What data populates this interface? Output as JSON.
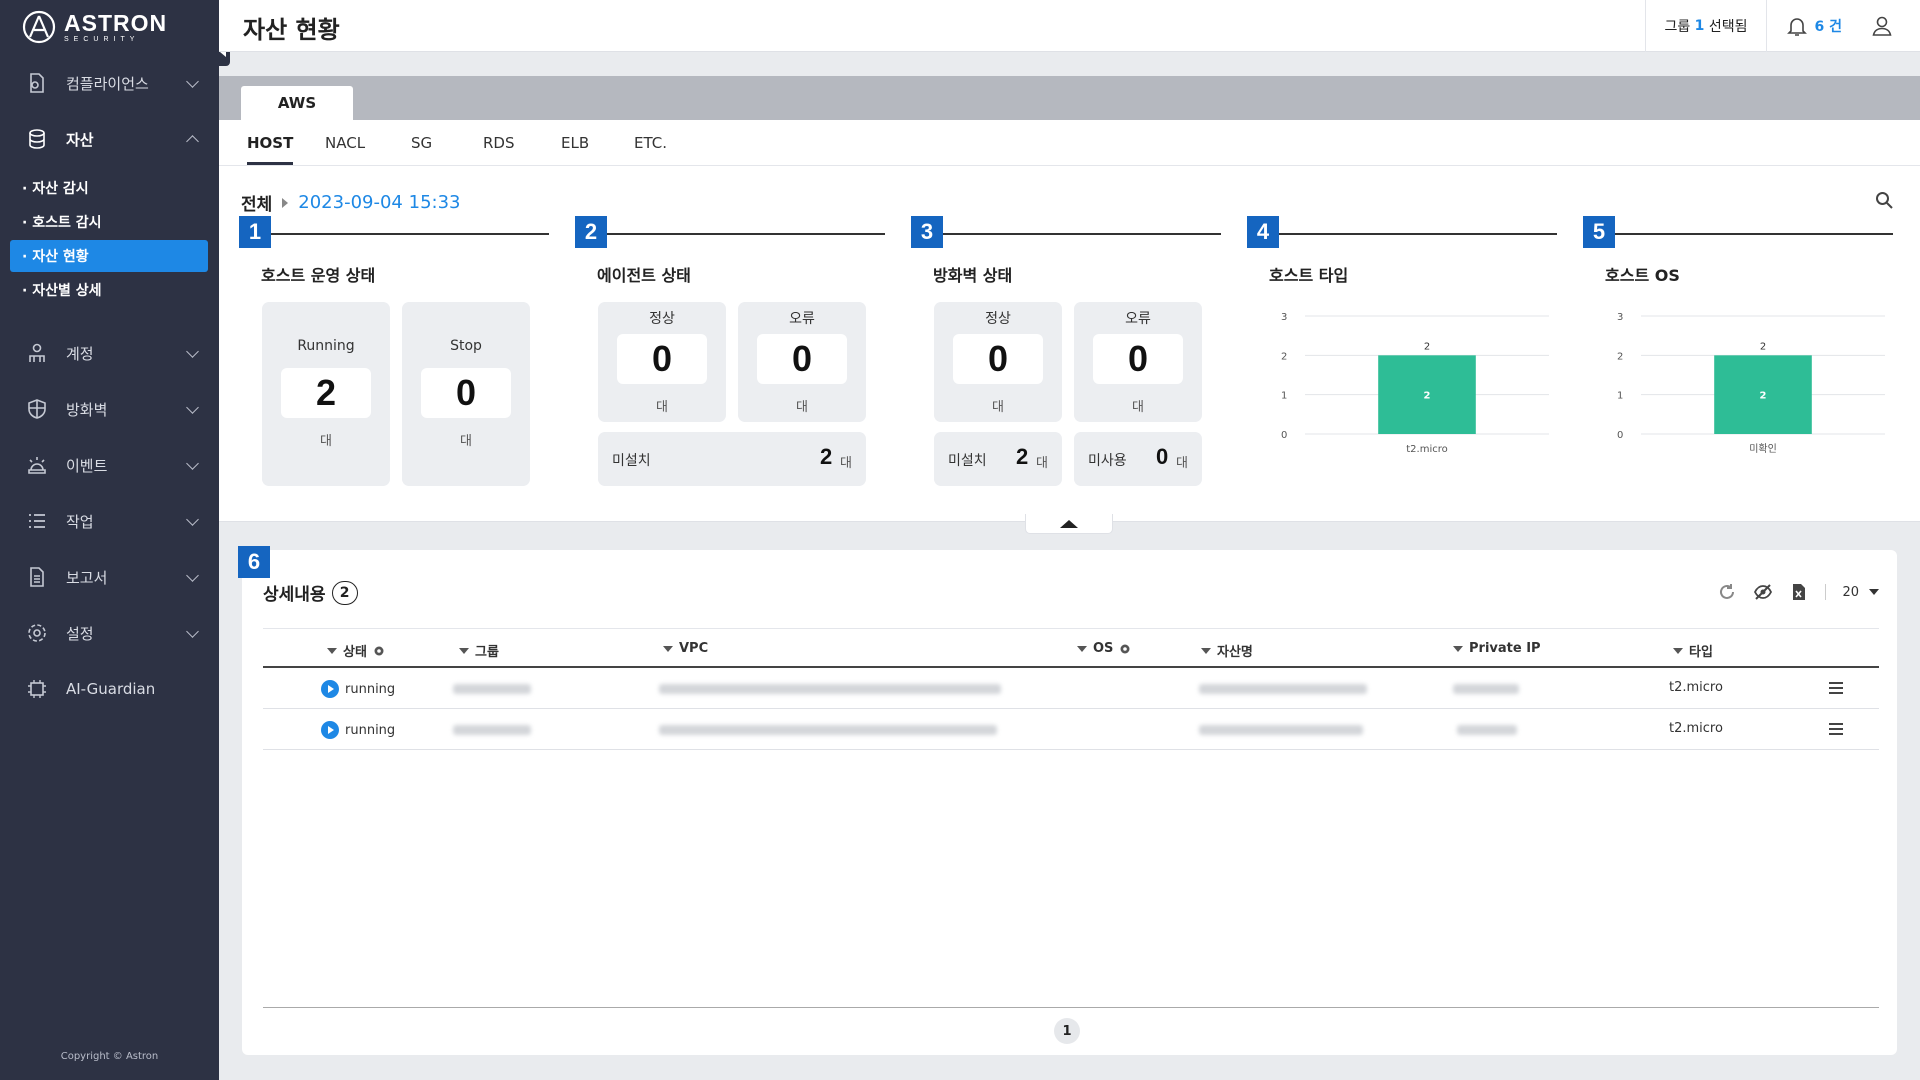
{
  "brand": {
    "name": "ASTRON",
    "tagline": "SECURITY"
  },
  "header": {
    "title": "자산 현황",
    "group_prefix": "그룹",
    "group_count": "1",
    "group_suffix": "선택됨",
    "notif_count": "6 건"
  },
  "sidebar": {
    "items": [
      {
        "label": "컴플라이언스",
        "icon": "compliance-icon"
      },
      {
        "label": "자산",
        "icon": "database-icon"
      },
      {
        "label": "계정",
        "icon": "account-icon"
      },
      {
        "label": "방화벽",
        "icon": "shield-icon"
      },
      {
        "label": "이벤트",
        "icon": "alarm-icon"
      },
      {
        "label": "작업",
        "icon": "list-icon"
      },
      {
        "label": "보고서",
        "icon": "report-icon"
      },
      {
        "label": "설정",
        "icon": "gear-icon"
      },
      {
        "label": "AI-Guardian",
        "icon": "ai-chip-icon"
      }
    ],
    "subitems": [
      "· 자산 감시",
      "· 호스트 감시",
      "· 자산 현황",
      "· 자산별 상세"
    ],
    "copyright": "Copyright © Astron"
  },
  "tabs": {
    "cloud": "AWS",
    "sub": [
      "HOST",
      "NACL",
      "SG",
      "RDS",
      "ELB",
      "ETC."
    ]
  },
  "summary": {
    "crumb_all": "전체",
    "datetime": "2023-09-04 15:33",
    "host_status": {
      "badge": "1",
      "title": "호스트 운영 상태",
      "running_label": "Running",
      "running_value": "2",
      "stop_label": "Stop",
      "stop_value": "0",
      "unit": "대"
    },
    "agent_status": {
      "badge": "2",
      "title": "에이전트 상태",
      "normal_label": "정상",
      "normal_value": "0",
      "error_label": "오류",
      "error_value": "0",
      "unit": "대",
      "uninstalled_label": "미설치",
      "uninstalled_value": "2"
    },
    "firewall_status": {
      "badge": "3",
      "title": "방화벽 상태",
      "normal_label": "정상",
      "normal_value": "0",
      "error_label": "오류",
      "error_value": "0",
      "unit": "대",
      "uninstalled_label": "미설치",
      "uninstalled_value": "2",
      "unused_label": "미사용",
      "unused_value": "0"
    },
    "host_type": {
      "badge": "4",
      "title": "호스트 타입"
    },
    "host_os": {
      "badge": "5",
      "title": "호스트 OS"
    }
  },
  "chart_data": [
    {
      "type": "bar",
      "title": "호스트 타입",
      "categories": [
        "t2.micro"
      ],
      "values": [
        2
      ],
      "ylim": [
        0,
        3
      ],
      "yticks": [
        "0",
        "1",
        "2",
        "3"
      ],
      "color": "#2ebd96"
    },
    {
      "type": "bar",
      "title": "호스트 OS",
      "categories": [
        "미확인"
      ],
      "values": [
        2
      ],
      "ylim": [
        0,
        3
      ],
      "yticks": [
        "0",
        "1",
        "2",
        "3"
      ],
      "color": "#2ebd96"
    }
  ],
  "detail": {
    "badge": "6",
    "title": "상세내용",
    "count": "2",
    "page_size": "20",
    "columns": [
      "상태",
      "그룹",
      "VPC",
      "OS",
      "자산명",
      "Private IP",
      "타입"
    ],
    "rows": [
      {
        "status": "running",
        "type": "t2.micro"
      },
      {
        "status": "running",
        "type": "t2.micro"
      }
    ],
    "page": "1"
  }
}
